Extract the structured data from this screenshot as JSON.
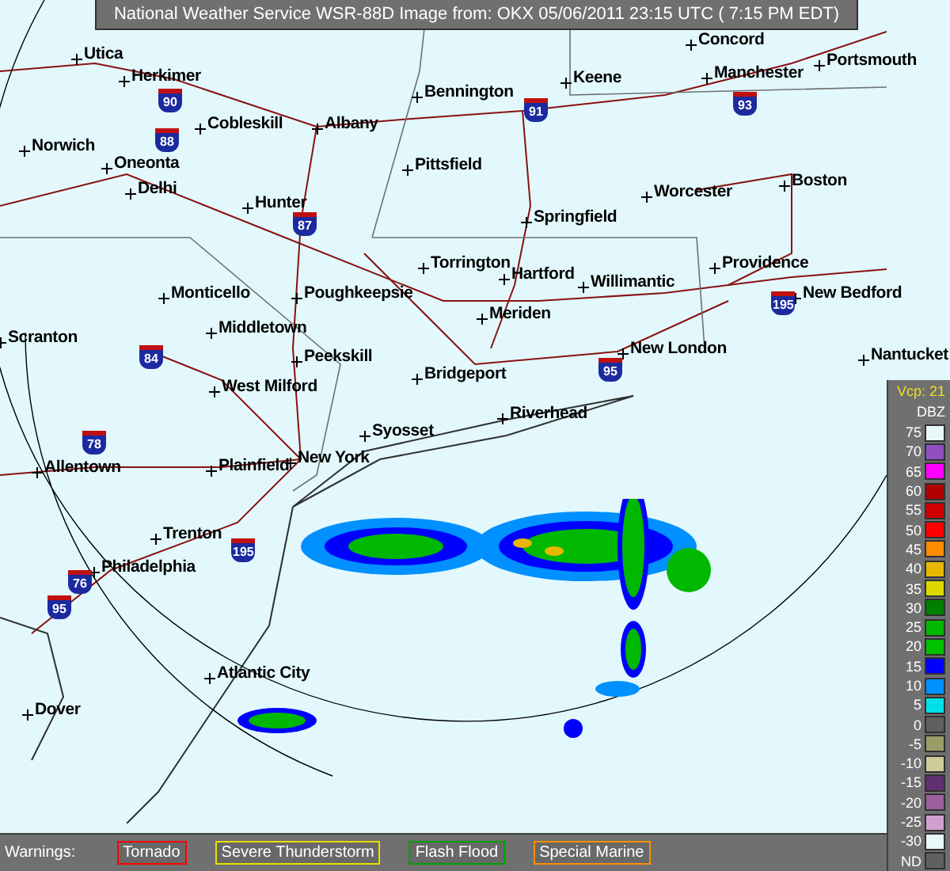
{
  "title": "National Weather Service WSR-88D Image from: OKX 05/06/2011 23:15 UTC ( 7:15 PM EDT)",
  "cities": [
    "Concord",
    "Utica",
    "Herkimer",
    "Manchester",
    "Portsmouth",
    "Keene",
    "Bennington",
    "Cobleskill",
    "Albany",
    "Norwich",
    "Oneonta",
    "Delhi",
    "Pittsfield",
    "Worcester",
    "Boston",
    "Hunter",
    "Springfield",
    "Torrington",
    "Providence",
    "Hartford",
    "Willimantic",
    "Monticello",
    "Poughkeepsie",
    "New Bedford",
    "Meriden",
    "Middletown",
    "Scranton",
    "Peekskill",
    "New London",
    "Nantucket",
    "Bridgeport",
    "West Milford",
    "Riverhead",
    "Syosset",
    "Allentown",
    "Plainfield",
    "New York",
    "Trenton",
    "Philadelphia",
    "Atlantic City",
    "Dover"
  ],
  "highways": [
    "90",
    "88",
    "87",
    "91",
    "93",
    "84",
    "78",
    "95",
    "195",
    "195",
    "76",
    "95"
  ],
  "legend": {
    "vcp": "Vcp: 21",
    "unit": "DBZ",
    "entries": [
      {
        "label": "75",
        "color": "#e8f8f8"
      },
      {
        "label": "70",
        "color": "#9050c0"
      },
      {
        "label": "65",
        "color": "#ff00ff"
      },
      {
        "label": "60",
        "color": "#b00000"
      },
      {
        "label": "55",
        "color": "#d00000"
      },
      {
        "label": "50",
        "color": "#ff0000"
      },
      {
        "label": "45",
        "color": "#ff8c00"
      },
      {
        "label": "40",
        "color": "#e8b800"
      },
      {
        "label": "35",
        "color": "#dcd800"
      },
      {
        "label": "30",
        "color": "#008000"
      },
      {
        "label": "25",
        "color": "#00b800"
      },
      {
        "label": "20",
        "color": "#00c000"
      },
      {
        "label": "15",
        "color": "#0000ff"
      },
      {
        "label": "10",
        "color": "#0090ff"
      },
      {
        "label": "5",
        "color": "#00e0e8"
      },
      {
        "label": "0",
        "color": "#606060"
      },
      {
        "label": "-5",
        "color": "#9c9c68"
      },
      {
        "label": "-10",
        "color": "#d0cc98"
      },
      {
        "label": "-15",
        "color": "#603070"
      },
      {
        "label": "-20",
        "color": "#9c60a0"
      },
      {
        "label": "-25",
        "color": "#d0a0d0"
      },
      {
        "label": "-30",
        "color": "#e8f8f8"
      },
      {
        "label": "ND",
        "color": "#606060"
      }
    ]
  },
  "warnings": {
    "label": "Warnings:",
    "items": [
      {
        "label": "Tornado",
        "color": "#ff0000"
      },
      {
        "label": "Severe Thunderstorm",
        "color": "#e8e000"
      },
      {
        "label": "Flash Flood",
        "color": "#00a000"
      },
      {
        "label": "Special Marine",
        "color": "#ff9000"
      }
    ]
  }
}
